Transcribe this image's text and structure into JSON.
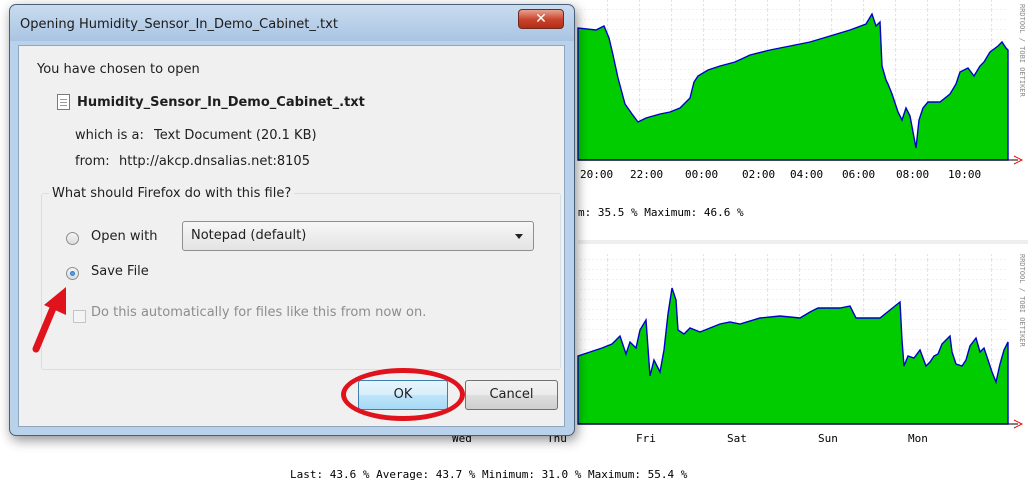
{
  "dialog": {
    "title": "Opening Humidity_Sensor_In_Demo_Cabinet_.txt",
    "close_label": "✕",
    "intro": "You have chosen to open",
    "file_name": "Humidity_Sensor_In_Demo_Cabinet_.txt",
    "type_label": "which is a:",
    "type_value": "Text Document (20.1 KB)",
    "from_label": "from:",
    "from_value": "http://akcp.dnsalias.net:8105",
    "question": "What should Firefox do with this file?",
    "open_with_label": "Open with",
    "open_with_value": "Notepad (default)",
    "save_file_label": "Save File",
    "save_file_selected": true,
    "auto_label": "Do this automatically for files like this from now on.",
    "ok_label": "OK",
    "cancel_label": "Cancel"
  },
  "annotation_colors": {
    "highlight": "#e0121b"
  },
  "background": {
    "top_graph": {
      "x_ticks": [
        "20:00",
        "22:00",
        "00:00",
        "02:00",
        "04:00",
        "06:00",
        "08:00",
        "10:00"
      ],
      "stats": "m: 35.5 %  Maximum: 46.6 %",
      "side_label": "RRDTOOL / TOBI OETIKER"
    },
    "bottom_graph": {
      "x_ticks": [
        "Wed",
        "Thu",
        "Fri",
        "Sat",
        "Sun",
        "Mon"
      ],
      "stats": "Last: 43.6 %  Average: 43.7 %  Minimum: 31.0 %  Maximum: 55.4 %",
      "side_label": "RRDTOOL / TOBI OETIKER"
    },
    "fill_color": "#00cc00",
    "line_color": "#0000cc"
  }
}
